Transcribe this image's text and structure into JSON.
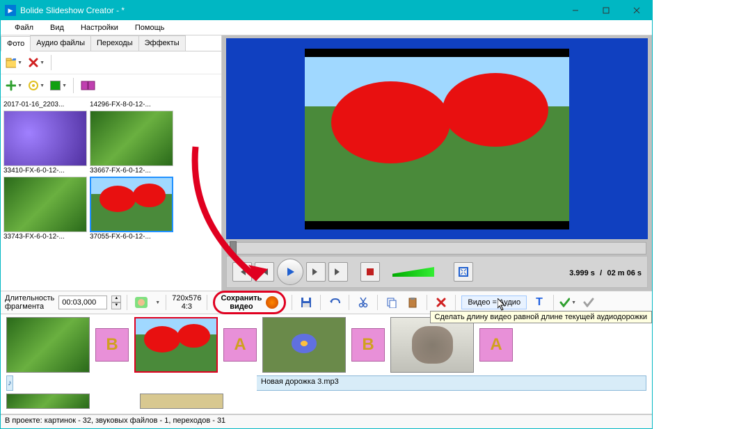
{
  "window": {
    "title": "Bolide Slideshow Creator - *"
  },
  "menu": [
    "Файл",
    "Вид",
    "Настройки",
    "Помощь"
  ],
  "tabs": [
    "Фото",
    "Аудио файлы",
    "Переходы",
    "Эффекты"
  ],
  "thumbs": [
    {
      "label": "2017-01-16_2203..."
    },
    {
      "label": "14296-FX-8-0-12-..."
    },
    {
      "label": "33410-FX-6-0-12-..."
    },
    {
      "label": "33667-FX-6-0-12-..."
    },
    {
      "label": "33743-FX-6-0-12-..."
    },
    {
      "label": "37055-FX-6-0-12-..."
    }
  ],
  "player": {
    "time_current": "3.999 s",
    "time_sep": "/",
    "time_total": "02 m 06 s"
  },
  "mid": {
    "duration_label_1": "Длительность",
    "duration_label_2": "фрагмента",
    "duration_value": "00:03,000",
    "res": "720x576",
    "ratio": "4:3",
    "save_line1": "Сохранить",
    "save_line2": "видео",
    "va_label": "Видео = Аудио",
    "va_text": "T"
  },
  "tooltip": "Сделать длину видео равной длине текущей аудиодорожки",
  "audio": {
    "track_name": "Новая дорожка 3.mp3"
  },
  "status": "В проекте: картинок - 32, звуковых файлов - 1, переходов - 31",
  "trans_letters": {
    "b": "B",
    "a": "A"
  }
}
